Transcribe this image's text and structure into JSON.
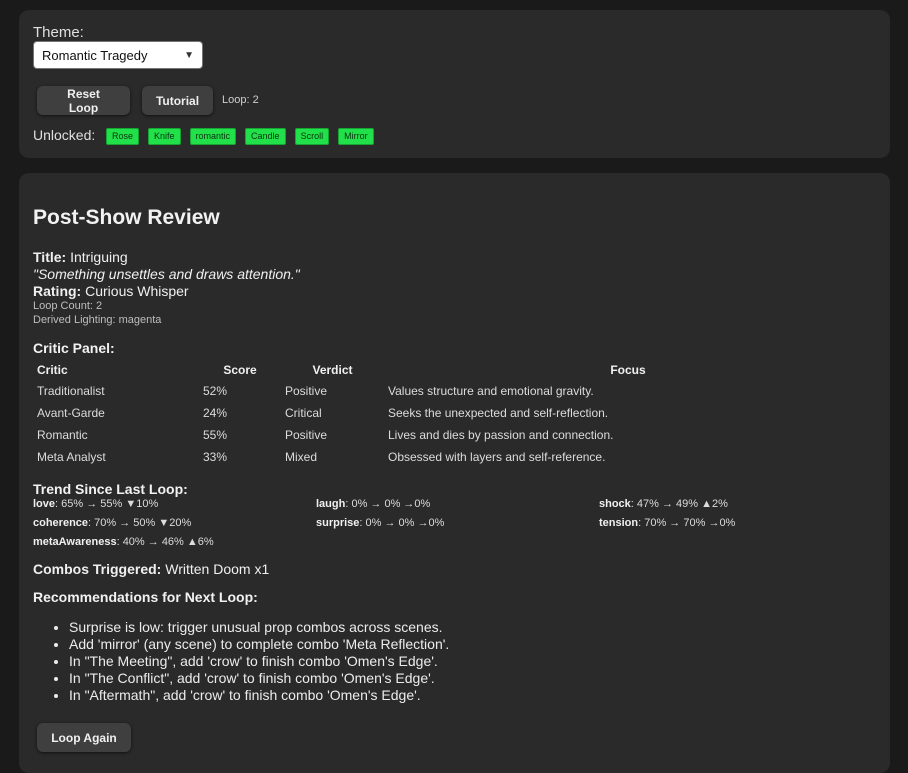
{
  "controls": {
    "theme_label": "Theme:",
    "theme_value": "Romantic Tragedy",
    "reset_label": "Reset Loop",
    "tutorial_label": "Tutorial",
    "loop_text": "Loop: 2",
    "unlocked_label": "Unlocked:",
    "tags": [
      "Rose",
      "Knife",
      "romantic",
      "Candle",
      "Scroll",
      "Mirror"
    ],
    "tag_color": "#22e04a"
  },
  "review": {
    "heading": "Post-Show Review",
    "title_label": "Title:",
    "title_value": "Intriguing",
    "quote": "\"Something unsettles and draws attention.\"",
    "rating_label": "Rating:",
    "rating_value": "Curious Whisper",
    "loop_count": "Loop Count: 2",
    "lighting": "Derived Lighting: magenta",
    "critic_panel_label": "Critic Panel:",
    "critic_headers": [
      "Critic",
      "Score",
      "Verdict",
      "Focus"
    ],
    "critics": [
      {
        "critic": "Traditionalist",
        "score": "52%",
        "verdict": "Positive",
        "focus": "Values structure and emotional gravity."
      },
      {
        "critic": "Avant-Garde",
        "score": "24%",
        "verdict": "Critical",
        "focus": "Seeks the unexpected and self-reflection."
      },
      {
        "critic": "Romantic",
        "score": "55%",
        "verdict": "Positive",
        "focus": "Lives and dies by passion and connection."
      },
      {
        "critic": "Meta Analyst",
        "score": "33%",
        "verdict": "Mixed",
        "focus": "Obsessed with layers and self-reference."
      }
    ],
    "trend_label": "Trend Since Last Loop:",
    "trends": [
      {
        "name": "love",
        "text": ": 65% → 55% ▼10%"
      },
      {
        "name": "laugh",
        "text": ": 0% → 0% →0%"
      },
      {
        "name": "shock",
        "text": ": 47% → 49% ▲2%"
      },
      {
        "name": "coherence",
        "text": ": 70% → 50% ▼20%"
      },
      {
        "name": "surprise",
        "text": ": 0% → 0% →0%"
      },
      {
        "name": "tension",
        "text": ": 70% → 70% →0%"
      },
      {
        "name": "metaAwareness",
        "text": ": 40% → 46% ▲6%"
      }
    ],
    "combos_label": "Combos Triggered:",
    "combos_value": "Written Doom x1",
    "recs_label": "Recommendations for Next Loop:",
    "recommendations": [
      "Surprise is low: trigger unusual prop combos across scenes.",
      "Add 'mirror' (any scene) to complete combo 'Meta Reflection'.",
      "In \"The Meeting\", add 'crow' to finish combo 'Omen's Edge'.",
      "In \"The Conflict\", add 'crow' to finish combo 'Omen's Edge'.",
      "In \"Aftermath\", add 'crow' to finish combo 'Omen's Edge'."
    ],
    "loop_again_label": "Loop Again"
  }
}
